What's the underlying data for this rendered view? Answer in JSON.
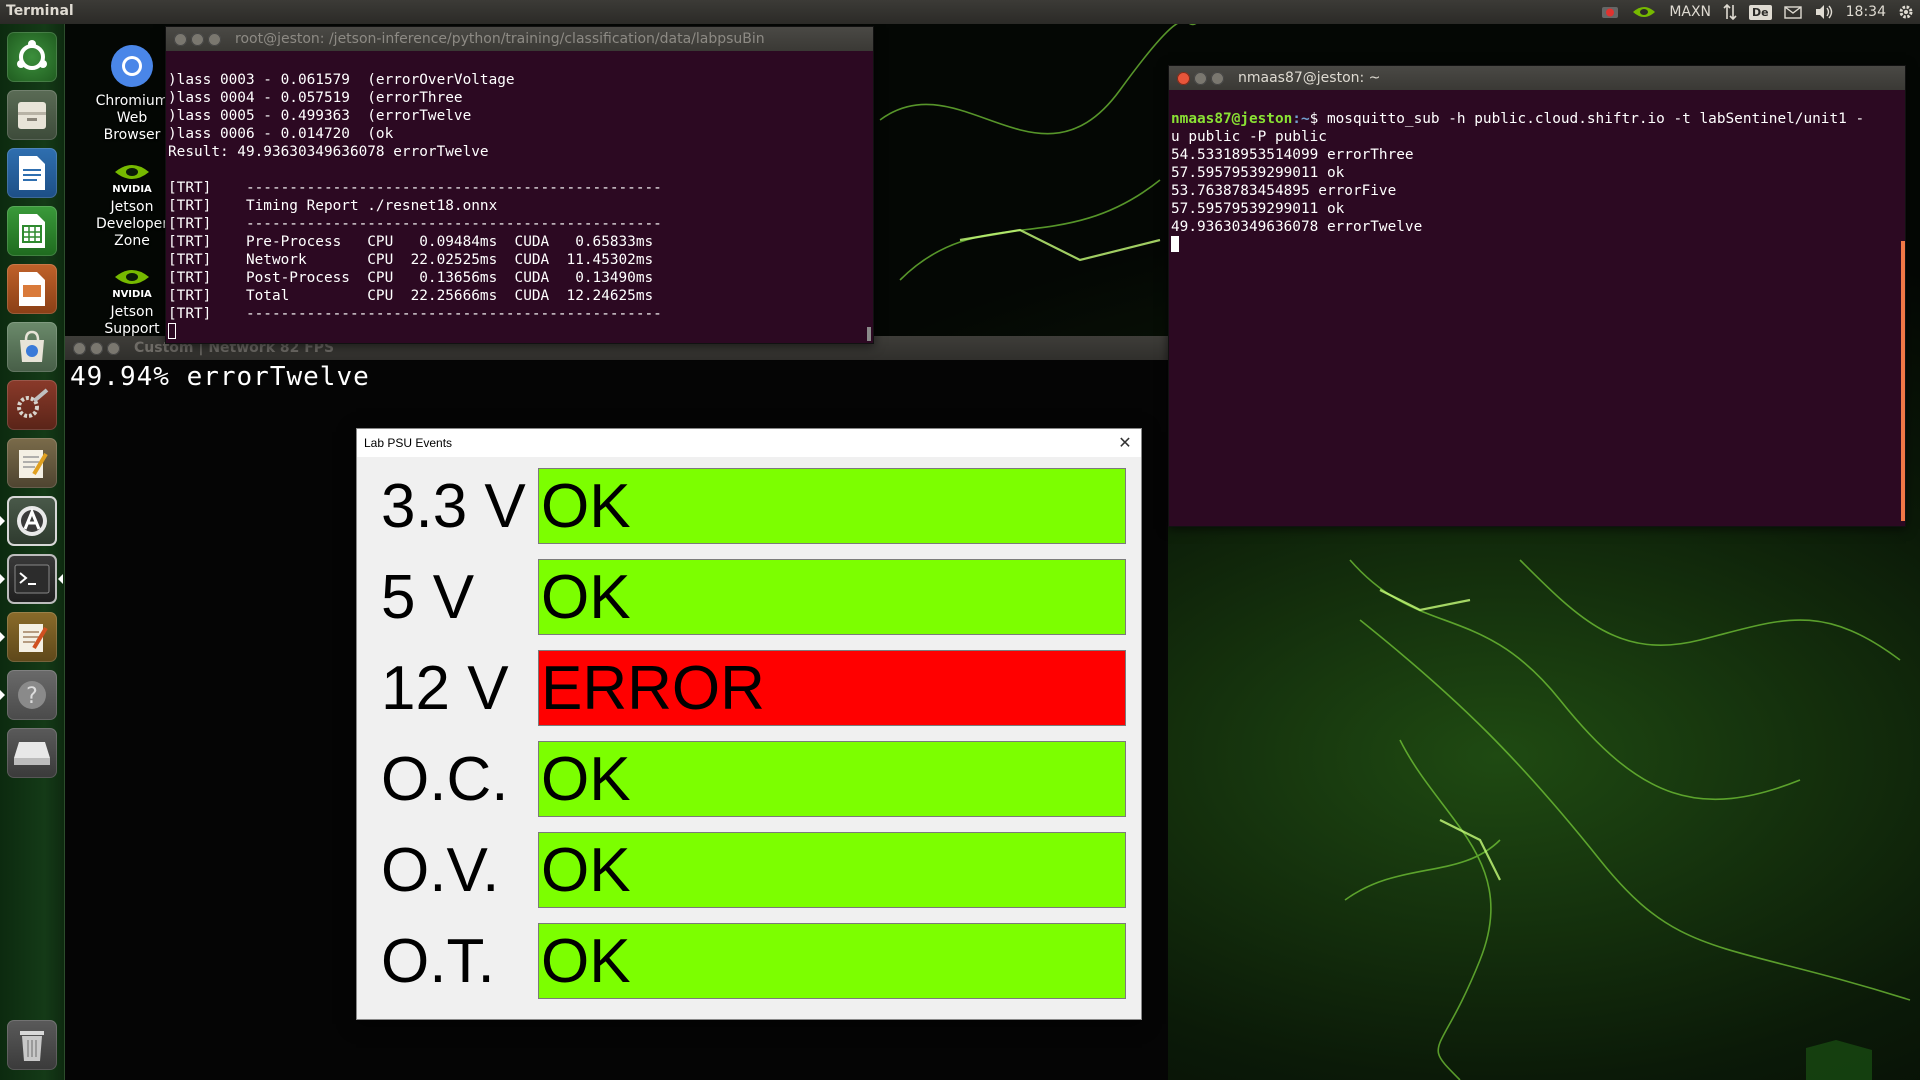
{
  "top_panel": {
    "app_title": "Terminal",
    "power_mode": "MAXN",
    "keyboard_layout": "De",
    "clock": "18:34"
  },
  "desktop_icons": [
    {
      "label": "Chromium\nWeb\nBrowser"
    },
    {
      "label": "Jetson\nDeveloper\nZone"
    },
    {
      "label": "Jetson\nSupport"
    }
  ],
  "nvidia_label": "NVIDIA",
  "terminal_left": {
    "title": "root@jeston: /jetson-inference/python/training/classification/data/labpsuBin",
    "lines": [
      ")lass 0003 - 0.061579  (errorOverVoltage",
      ")lass 0004 - 0.057519  (errorThree",
      ")lass 0005 - 0.499363  (errorTwelve",
      ")lass 0006 - 0.014720  (ok",
      "Result: 49.93630349636078 errorTwelve",
      "",
      "[TRT]    ------------------------------------------------",
      "[TRT]    Timing Report ./resnet18.onnx",
      "[TRT]    ------------------------------------------------",
      "[TRT]    Pre-Process   CPU   0.09484ms  CUDA   0.65833ms",
      "[TRT]    Network       CPU  22.02525ms  CUDA  11.45302ms",
      "[TRT]    Post-Process  CPU   0.13656ms  CUDA   0.13490ms",
      "[TRT]    Total         CPU  22.25666ms  CUDA  12.24625ms",
      "[TRT]    ------------------------------------------------"
    ]
  },
  "terminal_right": {
    "title": "nmaas87@jeston: ~",
    "prompt_user": "nmaas87@jeston",
    "prompt_path": ":~",
    "command": "$ mosquitto_sub -h public.cloud.shiftr.io -t labSentinel/unit1 -",
    "command_cont": "u public -P public",
    "lines": [
      "54.53318953514099 errorThree",
      "57.59579539299011 ok",
      "53.7638783454895 errorFive",
      "57.59579539299011 ok",
      "49.93630349636078 errorTwelve"
    ]
  },
  "camera_window": {
    "title": "Custom | Network 82 FPS",
    "overlay": "49.94% errorTwelve"
  },
  "psu_dialog": {
    "title": "Lab PSU Events",
    "close_glyph": "✕",
    "rows": [
      {
        "label": "3.3 V",
        "status": "OK",
        "color": "#7cff00"
      },
      {
        "label": "5 V",
        "status": "OK",
        "color": "#7cff00"
      },
      {
        "label": "12 V",
        "status": "ERROR",
        "color": "#ff0000"
      },
      {
        "label": "O.C.",
        "status": "OK",
        "color": "#7cff00"
      },
      {
        "label": "O.V.",
        "status": "OK",
        "color": "#7cff00"
      },
      {
        "label": "O.T.",
        "status": "OK",
        "color": "#7cff00"
      }
    ]
  },
  "launcher_items": [
    {
      "icon": "ubuntu-dash-icon"
    },
    {
      "icon": "file-manager-icon"
    },
    {
      "icon": "libreoffice-writer-icon"
    },
    {
      "icon": "libreoffice-calc-icon"
    },
    {
      "icon": "libreoffice-impress-icon"
    },
    {
      "icon": "software-center-icon"
    },
    {
      "icon": "system-settings-icon"
    },
    {
      "icon": "text-editor-icon"
    },
    {
      "icon": "software-updater-icon"
    },
    {
      "icon": "terminal-icon"
    },
    {
      "icon": "notes-icon"
    },
    {
      "icon": "help-icon"
    },
    {
      "icon": "drive-icon"
    },
    {
      "icon": "trash-icon"
    }
  ]
}
